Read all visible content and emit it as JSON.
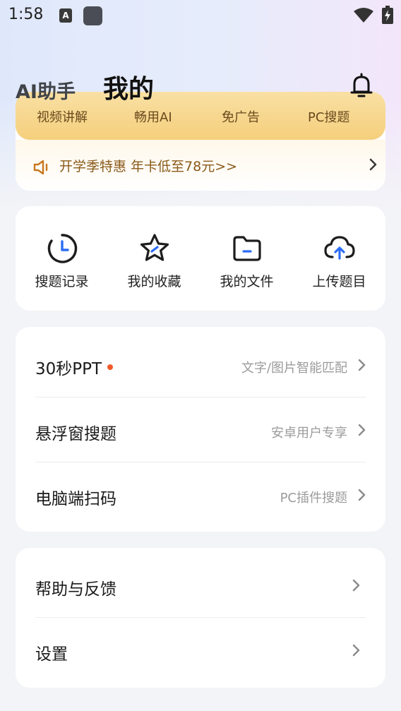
{
  "status_bar": {
    "time": "1:58",
    "notification_badge": "A"
  },
  "header": {
    "tab_ai": "AI助手",
    "tab_mine": "我的"
  },
  "promo": {
    "features": [
      "视频讲解",
      "畅用AI",
      "免广告",
      "PC搜题"
    ],
    "offer_text": "开学季特惠 年卡低至78元>>"
  },
  "shortcuts": [
    {
      "label": "搜题记录",
      "icon": "clock-icon"
    },
    {
      "label": "我的收藏",
      "icon": "star-icon"
    },
    {
      "label": "我的文件",
      "icon": "folder-icon"
    },
    {
      "label": "上传题目",
      "icon": "cloud-upload-icon"
    }
  ],
  "tools": [
    {
      "title": "30秒PPT",
      "subtitle": "文字/图片智能匹配",
      "has_dot": true
    },
    {
      "title": "悬浮窗搜题",
      "subtitle": "安卓用户专享",
      "has_dot": false
    },
    {
      "title": "电脑端扫码",
      "subtitle": "PC插件搜题",
      "has_dot": false
    }
  ],
  "settings": [
    {
      "title": "帮助与反馈"
    },
    {
      "title": "设置"
    }
  ],
  "colors": {
    "accent_dot": "#f25a2a",
    "gold": "#f5cf7c",
    "offer_text": "#8a5a1a"
  }
}
